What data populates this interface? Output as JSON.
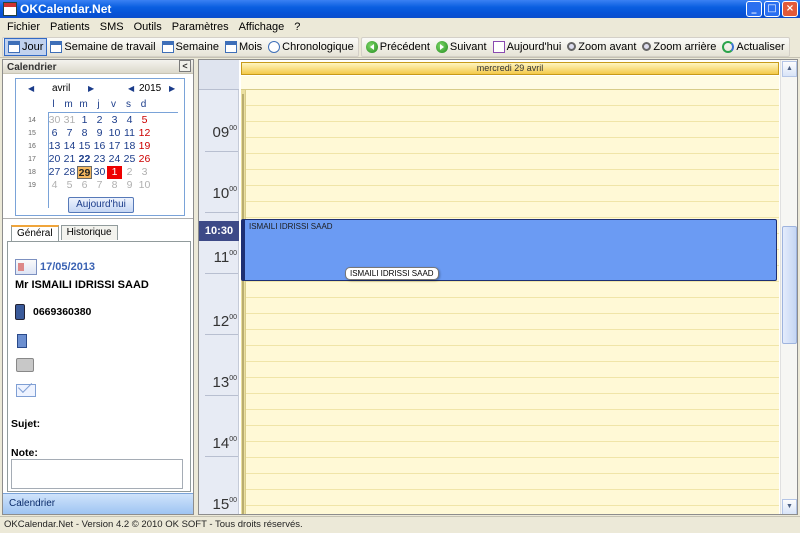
{
  "window": {
    "title": "OKCalendar.Net",
    "buttons": {
      "minimize": "_",
      "maximize": "□",
      "close": "×"
    }
  },
  "menu": [
    "Fichier",
    "Patients",
    "SMS",
    "Outils",
    "Paramètres",
    "Affichage",
    "?"
  ],
  "toolbar": {
    "views": [
      "Jour",
      "Semaine de travail",
      "Semaine",
      "Mois",
      "Chronologique"
    ],
    "nav": [
      "Précédent",
      "Suivant",
      "Aujourd'hui",
      "Zoom avant",
      "Zoom arrière",
      "Actualiser"
    ]
  },
  "sidebar": {
    "header": "Calendrier",
    "collapse": "<",
    "mini_calendar": {
      "month": "avril",
      "year": "2015",
      "days_of_week": [
        "l",
        "m",
        "m",
        "j",
        "v",
        "s",
        "d"
      ],
      "weeks": [
        {
          "wk": "14",
          "days": [
            "30",
            "31",
            "1",
            "2",
            "3",
            "4",
            "5"
          ]
        },
        {
          "wk": "15",
          "days": [
            "6",
            "7",
            "8",
            "9",
            "10",
            "11",
            "12"
          ]
        },
        {
          "wk": "16",
          "days": [
            "13",
            "14",
            "15",
            "16",
            "17",
            "18",
            "19"
          ]
        },
        {
          "wk": "17",
          "days": [
            "20",
            "21",
            "22",
            "23",
            "24",
            "25",
            "26"
          ]
        },
        {
          "wk": "18",
          "days": [
            "27",
            "28",
            "29",
            "30",
            "1",
            "2",
            "3"
          ]
        },
        {
          "wk": "19",
          "days": [
            "4",
            "5",
            "6",
            "7",
            "8",
            "9",
            "10"
          ]
        }
      ],
      "today_button": "Aujourd'hui"
    },
    "tabs": [
      "Général",
      "Historique"
    ],
    "patient": {
      "date": "17/05/2013",
      "name": "Mr ISMAILI IDRISSI SAAD",
      "phone": "0669360380",
      "sujet_label": "Sujet:",
      "note_label": "Note:"
    },
    "footer": "Calendrier"
  },
  "calendar": {
    "day_header": "mercredi 29 avril",
    "hours": [
      {
        "h": "09",
        "m": "00"
      },
      {
        "h": "10",
        "m": "00"
      },
      {
        "h": "11",
        "m": "00"
      },
      {
        "h": "12",
        "m": "00"
      },
      {
        "h": "13",
        "m": "00"
      },
      {
        "h": "14",
        "m": "00"
      },
      {
        "h": "15",
        "m": "00"
      }
    ],
    "current_time": "10:30",
    "appointment": {
      "title": "ISMAILI IDRISSI SAAD",
      "tooltip": "ISMAILI IDRISSI SAAD",
      "color": "#6b9bf3"
    }
  },
  "statusbar": "OKCalendar.Net - Version 4.2 © 2010 OK SOFT - Tous droits réservés."
}
